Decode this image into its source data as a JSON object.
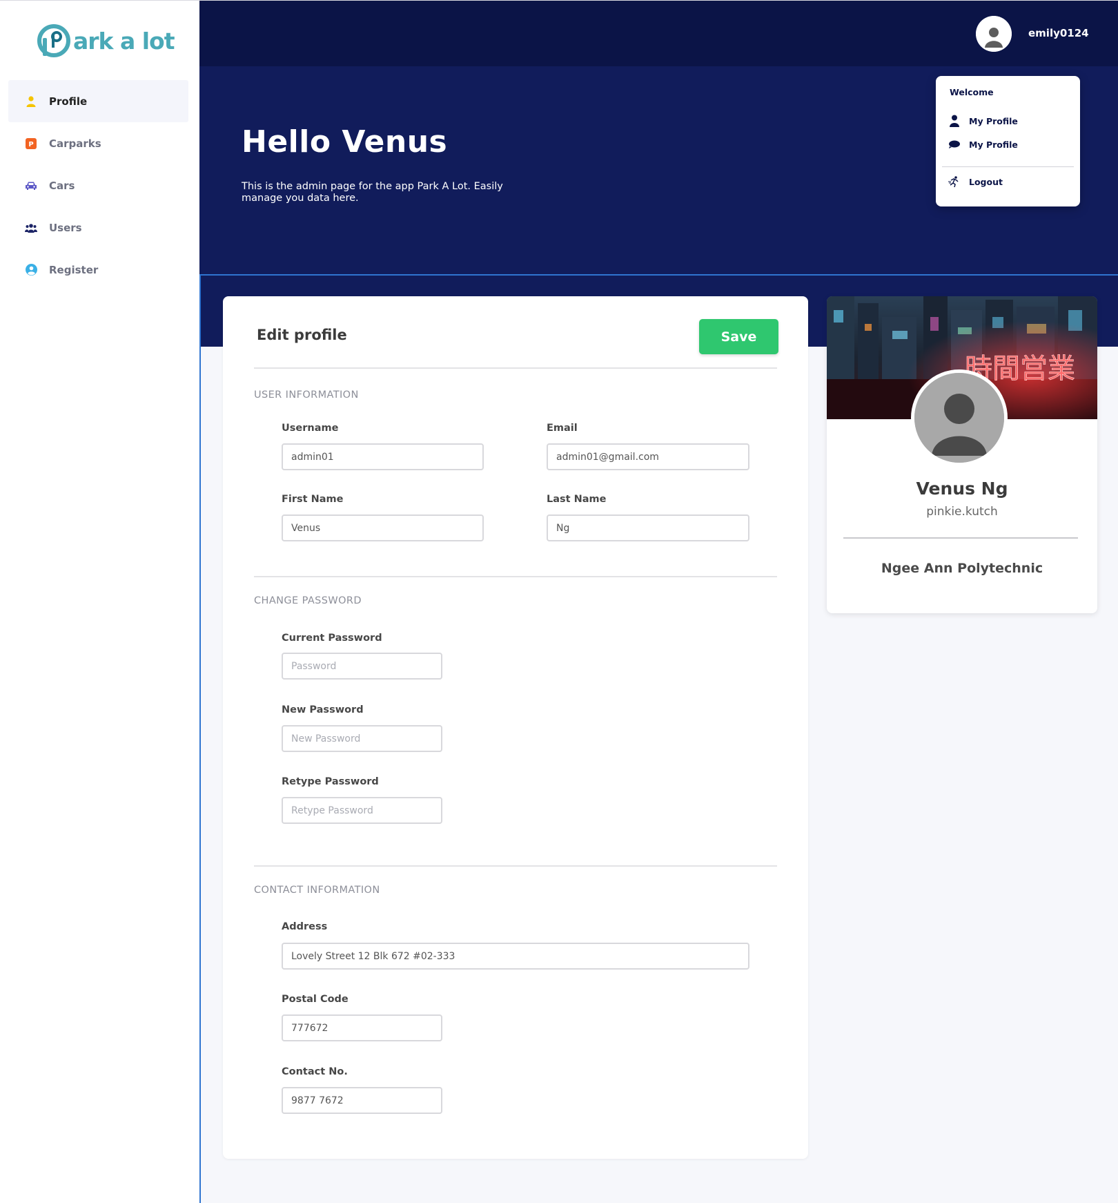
{
  "brand": {
    "logo_text": "ark a lot",
    "logo_icon": "parking-pin-logo"
  },
  "sidebar": {
    "items": [
      {
        "label": "Profile",
        "icon": "user-icon",
        "color": "#f5c400",
        "active": true
      },
      {
        "label": "Carparks",
        "icon": "parking-icon",
        "color": "#f26322",
        "active": false
      },
      {
        "label": "Cars",
        "icon": "car-icon",
        "color": "#5a56c6",
        "active": false
      },
      {
        "label": "Users",
        "icon": "users-icon",
        "color": "#1c2466",
        "active": false
      },
      {
        "label": "Register",
        "icon": "user-circle-icon",
        "color": "#3ab0e6",
        "active": false
      }
    ]
  },
  "topbar": {
    "username": "emily0124"
  },
  "hero": {
    "title": "Hello Venus",
    "text": "This is the admin page for the app Park A Lot. Easily manage you data here."
  },
  "dropdown": {
    "welcome": "Welcome",
    "items": [
      {
        "label": "My Profile",
        "icon": "person-icon"
      },
      {
        "label": "My Profile",
        "icon": "chat-bubble-icon"
      },
      {
        "label": "Logout",
        "icon": "logout-run-icon"
      }
    ]
  },
  "edit_profile": {
    "title": "Edit profile",
    "save_label": "Save",
    "user_info": {
      "section_title": "USER INFORMATION",
      "username": {
        "label": "Username",
        "value": "admin01"
      },
      "email": {
        "label": "Email",
        "value": "admin01@gmail.com"
      },
      "first_name": {
        "label": "First Name",
        "value": "Venus"
      },
      "last_name": {
        "label": "Last Name",
        "value": "Ng"
      }
    },
    "password": {
      "section_title": "CHANGE PASSWORD",
      "current": {
        "label": "Current Password",
        "placeholder": "Password"
      },
      "new": {
        "label": "New Password",
        "placeholder": "New Password"
      },
      "retype": {
        "label": "Retype Password",
        "placeholder": "Retype Password"
      }
    },
    "contact": {
      "section_title": "CONTACT INFORMATION",
      "address": {
        "label": "Address",
        "value": "Lovely Street 12 Blk 672 #02-333"
      },
      "postal": {
        "label": "Postal Code",
        "value": "777672"
      },
      "phone": {
        "label": "Contact No.",
        "value": "9877 7672"
      }
    }
  },
  "profile_card": {
    "name": "Venus Ng",
    "username": "pinkie.kutch",
    "organization": "Ngee Ann Polytechnic",
    "cover_sign": "時間営業"
  },
  "colors": {
    "topbar": "#0b1447",
    "hero": "#111c5b",
    "save_button": "#2fc76f",
    "accent_line": "#2f74d0"
  }
}
